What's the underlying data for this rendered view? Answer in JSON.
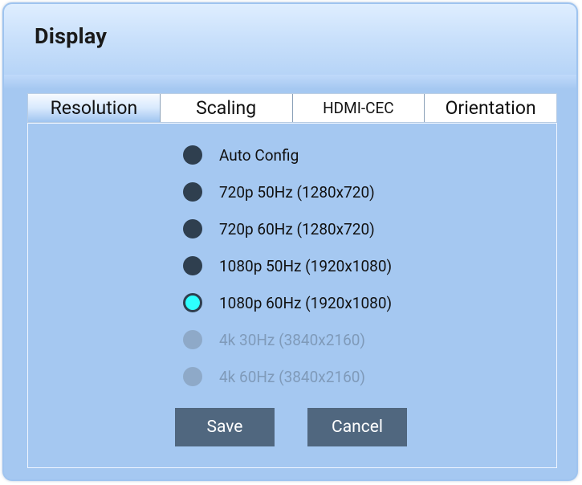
{
  "dialog": {
    "title": "Display"
  },
  "tabs": [
    {
      "label": "Resolution",
      "active": true
    },
    {
      "label": "Scaling",
      "active": false
    },
    {
      "label": "HDMI-CEC",
      "active": false
    },
    {
      "label": "Orientation",
      "active": false
    }
  ],
  "resolution": {
    "options": [
      {
        "label": "Auto Config",
        "state": "unselected"
      },
      {
        "label": "720p 50Hz (1280x720)",
        "state": "unselected"
      },
      {
        "label": "720p 60Hz (1280x720)",
        "state": "unselected"
      },
      {
        "label": "1080p 50Hz (1920x1080)",
        "state": "unselected"
      },
      {
        "label": "1080p 60Hz (1920x1080)",
        "state": "selected"
      },
      {
        "label": "4k 30Hz (3840x2160)",
        "state": "disabled"
      },
      {
        "label": "4k 60Hz (3840x2160)",
        "state": "disabled"
      }
    ]
  },
  "buttons": {
    "save_label": "Save",
    "cancel_label": "Cancel"
  },
  "colors": {
    "background": "#a5c8f1",
    "radio_unselected": "#2f3f4f",
    "radio_selected": "#2effff",
    "radio_disabled": "#8ea9c8",
    "button": "#50677f"
  }
}
